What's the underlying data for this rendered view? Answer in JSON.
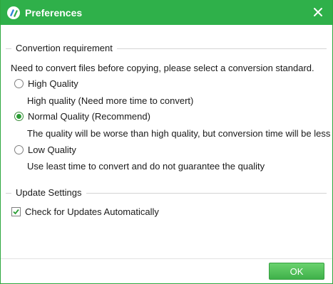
{
  "window": {
    "title": "Preferences"
  },
  "conversion": {
    "group_label": "Convertion requirement",
    "intro": "Need to convert files before copying, please select a conversion standard.",
    "options": [
      {
        "label": "High Quality",
        "description": "High quality (Need more time to convert)",
        "selected": false
      },
      {
        "label": "Normal Quality (Recommend)",
        "description": "The quality will be worse than high quality, but conversion time will be less",
        "selected": true
      },
      {
        "label": "Low Quality",
        "description": "Use least time to convert and do not guarantee the quality",
        "selected": false
      }
    ]
  },
  "update": {
    "group_label": "Update Settings",
    "check_label": "Check for Updates Automatically",
    "checked": true
  },
  "footer": {
    "ok_label": "OK"
  },
  "colors": {
    "title_bar": "#2fb04a",
    "accent": "#2a9d35"
  }
}
